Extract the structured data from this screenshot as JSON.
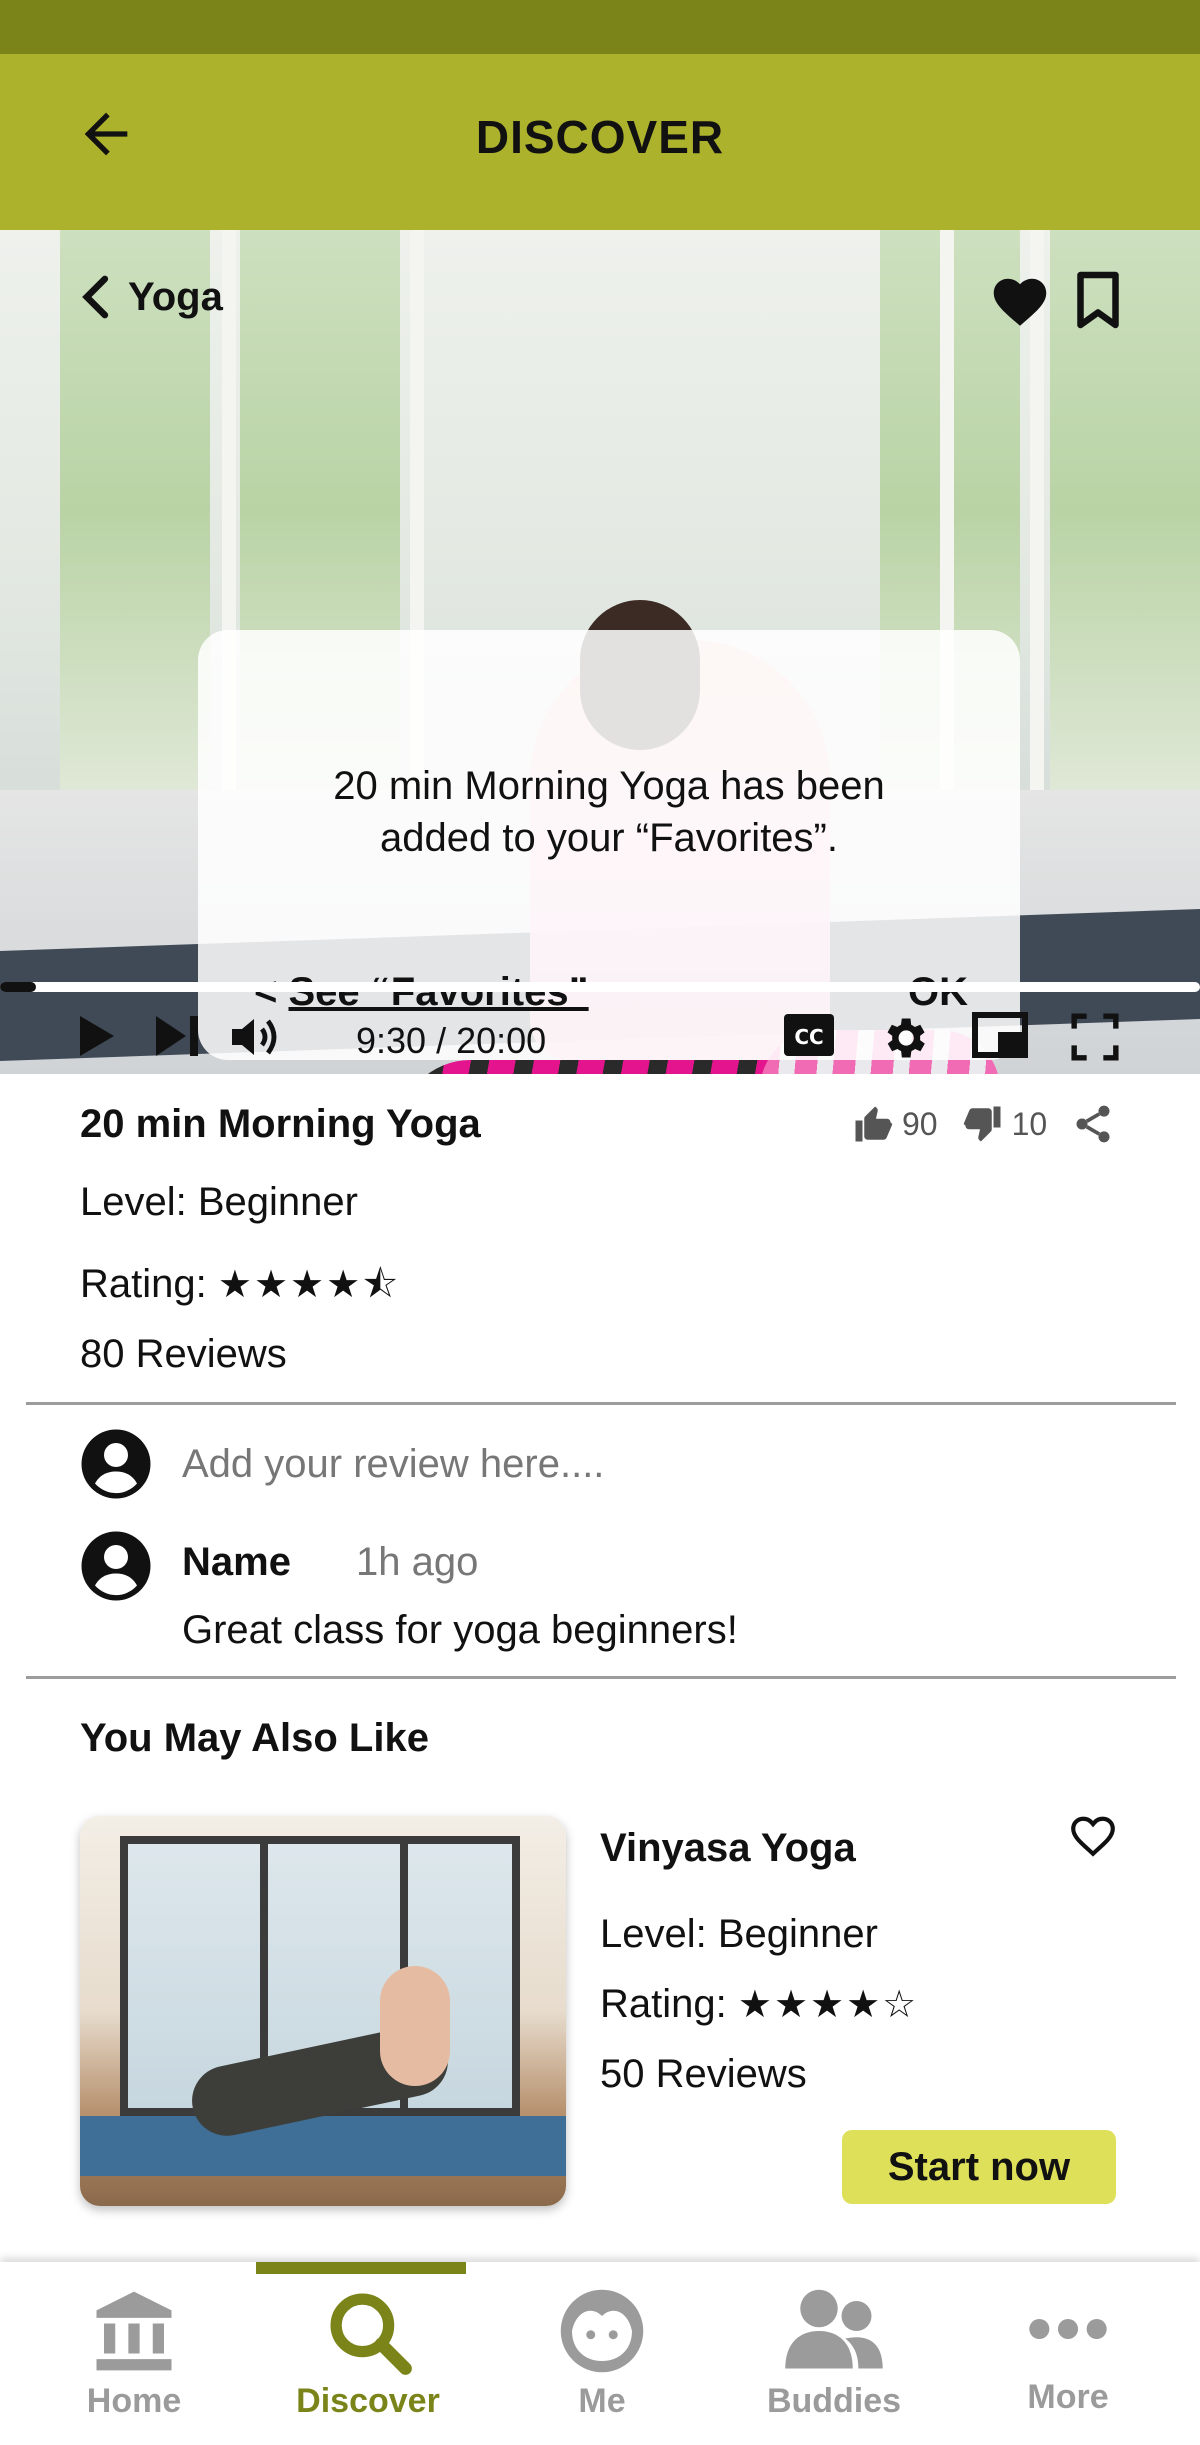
{
  "header": {
    "title": "DISCOVER"
  },
  "video": {
    "category": "Yoga",
    "time_display": "9:30 / 20:00",
    "progress": 0.03
  },
  "modal": {
    "message_line1": "20 min Morning Yoga has been",
    "message_line2": "added to your “Favorites”.",
    "see_favorites_prefix": "< ",
    "see_favorites_label": "See “Favorites”",
    "ok_label": "OK"
  },
  "details": {
    "title": "20 min Morning Yoga",
    "likes": "90",
    "dislikes": "10",
    "level": "Level: Beginner",
    "rating_label": "Rating:",
    "rating_stars": "★★★★⯪",
    "rating_value": 4.5,
    "reviews": "80 Reviews"
  },
  "review": {
    "placeholder": "Add your review here....",
    "author": "Name",
    "time": "1h ago",
    "text": "Great class for yoga beginners!"
  },
  "recommendations": {
    "section_title": "You May Also Like",
    "items": [
      {
        "title": "Vinyasa Yoga",
        "level": "Level: Beginner",
        "rating_label": "Rating:",
        "rating_stars": "★★★★☆",
        "rating_value": 4,
        "reviews": "50 Reviews",
        "cta": "Start now"
      }
    ]
  },
  "nav": {
    "items": [
      {
        "label": "Home",
        "icon": "bank-icon"
      },
      {
        "label": "Discover",
        "icon": "search-icon",
        "active": true
      },
      {
        "label": "Me",
        "icon": "face-icon"
      },
      {
        "label": "Buddies",
        "icon": "people-icon"
      },
      {
        "label": "More",
        "icon": "more-dots-icon"
      }
    ]
  },
  "colors": {
    "status_bar": "#7a8419",
    "header": "#adb22c",
    "accent": "#7a8419",
    "cta": "#dfe05a"
  }
}
